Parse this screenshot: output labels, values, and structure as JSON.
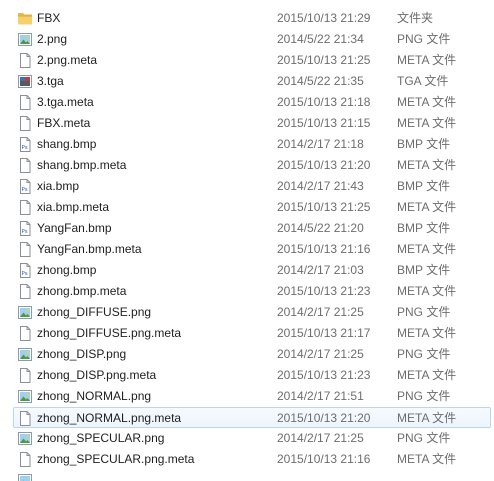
{
  "files": [
    {
      "name": "FBX",
      "date": "2015/10/13 21:29",
      "type": "文件夹",
      "icon": "folder-icon"
    },
    {
      "name": "2.png",
      "date": "2014/5/22 21:34",
      "type": "PNG 文件",
      "icon": "image-file-icon"
    },
    {
      "name": "2.png.meta",
      "date": "2015/10/13 21:25",
      "type": "META 文件",
      "icon": "blank-file-icon"
    },
    {
      "name": "3.tga",
      "date": "2014/5/22 21:35",
      "type": "TGA 文件",
      "icon": "tga-file-icon"
    },
    {
      "name": "3.tga.meta",
      "date": "2015/10/13 21:18",
      "type": "META 文件",
      "icon": "blank-file-icon"
    },
    {
      "name": "FBX.meta",
      "date": "2015/10/13 21:15",
      "type": "META 文件",
      "icon": "blank-file-icon"
    },
    {
      "name": "shang.bmp",
      "date": "2014/2/17 21:18",
      "type": "BMP 文件",
      "icon": "photoshop-file-icon"
    },
    {
      "name": "shang.bmp.meta",
      "date": "2015/10/13 21:20",
      "type": "META 文件",
      "icon": "blank-file-icon"
    },
    {
      "name": "xia.bmp",
      "date": "2014/2/17 21:43",
      "type": "BMP 文件",
      "icon": "photoshop-file-icon"
    },
    {
      "name": "xia.bmp.meta",
      "date": "2015/10/13 21:25",
      "type": "META 文件",
      "icon": "blank-file-icon"
    },
    {
      "name": "YangFan.bmp",
      "date": "2014/5/22 21:20",
      "type": "BMP 文件",
      "icon": "photoshop-file-icon"
    },
    {
      "name": "YangFan.bmp.meta",
      "date": "2015/10/13 21:16",
      "type": "META 文件",
      "icon": "blank-file-icon"
    },
    {
      "name": "zhong.bmp",
      "date": "2014/2/17 21:03",
      "type": "BMP 文件",
      "icon": "photoshop-file-icon"
    },
    {
      "name": "zhong.bmp.meta",
      "date": "2015/10/13 21:23",
      "type": "META 文件",
      "icon": "blank-file-icon"
    },
    {
      "name": "zhong_DIFFUSE.png",
      "date": "2014/2/17 21:25",
      "type": "PNG 文件",
      "icon": "image-file-icon"
    },
    {
      "name": "zhong_DIFFUSE.png.meta",
      "date": "2015/10/13 21:17",
      "type": "META 文件",
      "icon": "blank-file-icon"
    },
    {
      "name": "zhong_DISP.png",
      "date": "2014/2/17 21:25",
      "type": "PNG 文件",
      "icon": "image-file-icon"
    },
    {
      "name": "zhong_DISP.png.meta",
      "date": "2015/10/13 21:23",
      "type": "META 文件",
      "icon": "blank-file-icon"
    },
    {
      "name": "zhong_NORMAL.png",
      "date": "2014/2/17 21:51",
      "type": "PNG 文件",
      "icon": "image-file-icon"
    },
    {
      "name": "zhong_NORMAL.png.meta",
      "date": "2015/10/13 21:20",
      "type": "META 文件",
      "icon": "blank-file-icon",
      "selected": true
    },
    {
      "name": "zhong_SPECULAR.png",
      "date": "2014/2/17 21:25",
      "type": "PNG 文件",
      "icon": "image-file-icon"
    },
    {
      "name": "zhong_SPECULAR.png.meta",
      "date": "2015/10/13 21:16",
      "type": "META 文件",
      "icon": "blank-file-icon"
    }
  ]
}
